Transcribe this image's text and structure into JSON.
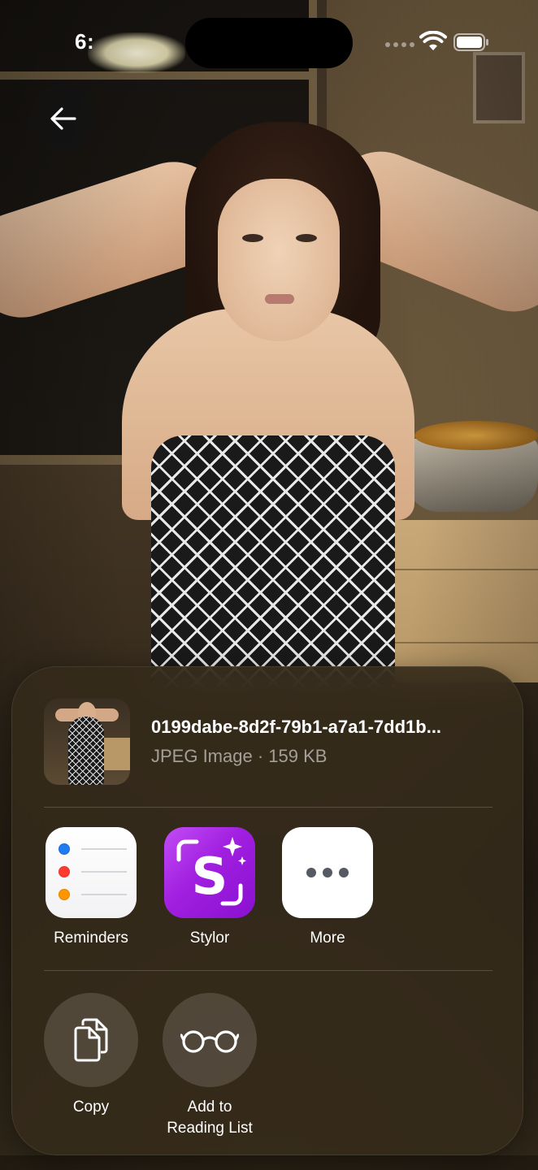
{
  "status_bar": {
    "time": "6:",
    "wifi_icon": "wifi-icon",
    "battery_icon": "battery-icon"
  },
  "navigation": {
    "back_icon": "arrow-left-icon"
  },
  "share_sheet": {
    "file_name": "0199dabe-8d2f-79b1-a7a1-7dd1b...",
    "file_meta": "JPEG Image · 159 KB",
    "apps": [
      {
        "label": "Reminders",
        "icon": "reminders-app-icon"
      },
      {
        "label": "Stylor",
        "icon": "stylor-app-icon"
      },
      {
        "label": "More",
        "icon": "more-icon"
      }
    ],
    "actions": [
      {
        "label": "Copy",
        "icon": "copy-icon"
      },
      {
        "label": "Add to\nReading List",
        "label_line1": "Add to",
        "label_line2": "Reading List",
        "icon": "glasses-icon"
      }
    ]
  },
  "colors": {
    "sheet_background": "#342a1a",
    "stylor_purple": "#a11fe0",
    "reminders_dots": [
      "#1e7bf0",
      "#ff3b30",
      "#ff9500"
    ]
  }
}
